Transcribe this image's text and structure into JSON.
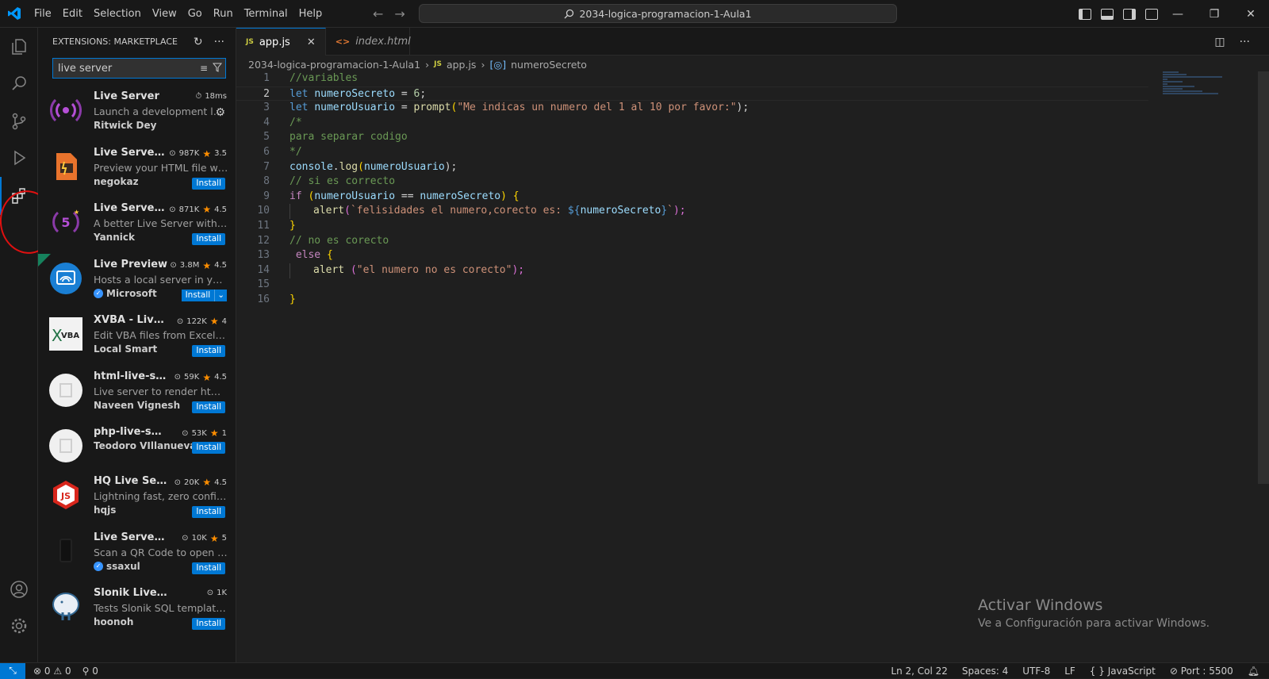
{
  "menu": [
    "File",
    "Edit",
    "Selection",
    "View",
    "Go",
    "Run",
    "Terminal",
    "Help"
  ],
  "command_center": "2034-logica-programacion-1-Aula1",
  "sidebar": {
    "title": "EXTENSIONS: MARKETPLACE",
    "search_value": "live server",
    "extensions": [
      {
        "name": "Live Server",
        "desc": "Launch a development local Server with live reload feature",
        "publisher": "Ritwick Dey",
        "time": "18ms"
      },
      {
        "name": "Live Server Preview",
        "desc": "Preview your HTML file with localhost server live-reloading",
        "publisher": "negokaz",
        "downloads": "987K",
        "rating": "3.5",
        "install": "Install"
      },
      {
        "name": "Live Server (Five Server)",
        "desc": "A better Live Server with instant updating",
        "publisher": "Yannick",
        "downloads": "871K",
        "rating": "4.5",
        "install": "Install"
      },
      {
        "name": "Live Preview",
        "desc": "Hosts a local server in your workspace",
        "publisher": "Microsoft",
        "downloads": "3.8M",
        "rating": "4.5",
        "install": "Install"
      },
      {
        "name": "XVBA - Live Server VBA",
        "desc": "Edit VBA files from Excel/Access",
        "publisher": "Local Smart",
        "downloads": "122K",
        "rating": "4",
        "install": "Install"
      },
      {
        "name": "html-live-server",
        "desc": "Live server to render html with hot reload",
        "publisher": "Naveen Vignesh",
        "downloads": "59K",
        "rating": "4.5",
        "install": "Install"
      },
      {
        "name": "php-live-server",
        "desc": "",
        "publisher": "Teodoro VIllanueva",
        "downloads": "53K",
        "rating": "1",
        "install": "Install"
      },
      {
        "name": "HQ Live Server",
        "desc": "Lightning fast, zero configuration",
        "publisher": "hqjs",
        "downloads": "20K",
        "rating": "4.5",
        "install": "Install"
      },
      {
        "name": "Live Server QR",
        "desc": "Scan a QR Code to open your live server",
        "publisher": "ssaxul",
        "downloads": "10K",
        "rating": "5",
        "install": "Install"
      },
      {
        "name": "Slonik Live Server",
        "desc": "Tests Slonik SQL template tags",
        "publisher": "hoonoh",
        "downloads": "1K",
        "install": "Install"
      }
    ]
  },
  "tabs": [
    {
      "label": "app.js",
      "badge": "JS"
    },
    {
      "label": "index.html",
      "badge": "<>"
    }
  ],
  "breadcrumb": {
    "folder": "2034-logica-programacion-1-Aula1",
    "file": "app.js",
    "symbol": "numeroSecreto"
  },
  "line_numbers": [
    "1",
    "2",
    "3",
    "4",
    "5",
    "6",
    "7",
    "8",
    "9",
    "10",
    "11",
    "12",
    "13",
    "14",
    "15",
    "16"
  ],
  "code": {
    "l1": "//variables",
    "l2_kw": "let",
    "l2_var": "numeroSecreto",
    "l2_eq": " = ",
    "l2_num": "6",
    "l2_end": ";",
    "l3_kw": "let",
    "l3_var": "numeroUsuario",
    "l3_eq": " = ",
    "l3_fn": "prompt",
    "l3_o": "(",
    "l3_str": "\"Me indicas un numero del 1 al 10 por favor:\"",
    "l3_c": ");",
    "l4": "/*",
    "l5": "para separar codigo",
    "l6": "*/",
    "l7_var": "console",
    "l7_dot": ".",
    "l7_fn": "log",
    "l7_o": "(",
    "l7_arg": "numeroUsuario",
    "l7_c": ");",
    "l8": "// si es correcto",
    "l9_kw": "if",
    "l9_o": " (",
    "l9_a": "numeroUsuario",
    "l9_op": " == ",
    "l9_b": "numeroSecreto",
    "l9_c": ") {",
    "l10_fn": "alert",
    "l10_o": "(",
    "l10_str": "`felisidades el numero,corecto es: ",
    "l10_tpl": "${",
    "l10_var": "numeroSecreto",
    "l10_tplc": "}",
    "l10_bt": "`",
    "l10_c": ");",
    "l11": "}",
    "l12": "// no es corecto",
    "l13_kw": " else",
    "l13_b": " {",
    "l14_fn": "alert",
    "l14_sp": " (",
    "l14_str": "\"el numero no es corecto\"",
    "l14_c": ");",
    "l15": "",
    "l16": "}"
  },
  "watermark": {
    "title": "Activar Windows",
    "subtitle": "Ve a Configuración para activar Windows."
  },
  "status": {
    "errors": "0",
    "warnings": "0",
    "ports": "0",
    "position": "Ln 2, Col 22",
    "spaces": "Spaces: 4",
    "encoding": "UTF-8",
    "eol": "LF",
    "language": "JavaScript",
    "port": "Port : 5500"
  },
  "colors": {
    "accent": "#0078d4",
    "annotation_red": "#e01010"
  }
}
